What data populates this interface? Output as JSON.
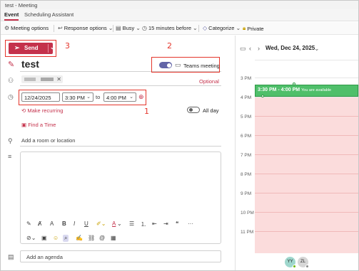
{
  "window": {
    "title": "test - Meeting"
  },
  "tabs": [
    {
      "label": "Event"
    },
    {
      "label": "Scheduling Assistant"
    }
  ],
  "toolbar": {
    "meeting_options": "Meeting options",
    "response_options": "Response options",
    "busy": "Busy",
    "reminder": "15 minutes before",
    "categorize": "Categorize",
    "private": "Private"
  },
  "send": {
    "label": "Send"
  },
  "form": {
    "title": "test",
    "teams_meeting_label": "Teams meeting",
    "teams_meeting_on": true,
    "optional_label": "Optional",
    "start_date": "12/24/2025",
    "start_time": "3:30 PM",
    "to_label": "to",
    "end_time": "4:00 PM",
    "all_day_label": "All day",
    "make_recurring": "Make recurring",
    "find_a_time": "Find a Time",
    "room_placeholder": "Add a room or location",
    "agenda_placeholder": "Add an agenda"
  },
  "annotations": {
    "one": "1",
    "two": "2",
    "three": "3"
  },
  "calendar": {
    "date_label": "Wed, Dec 24, 2025",
    "hours": [
      "3 PM",
      "4 PM",
      "5 PM",
      "6 PM",
      "7 PM",
      "8 PM",
      "9 PM",
      "10 PM",
      "11 PM"
    ],
    "event_time": "3:30 PM - 4:00 PM",
    "event_status": "You are available",
    "attendees": [
      {
        "initials": "YY",
        "status_color": "#6bb700"
      },
      {
        "initials": "ZL",
        "status_color": "#8a8a8a"
      }
    ]
  },
  "colors": {
    "accent": "#c4314b",
    "teams": "#6264a7",
    "event": "#4fbf6a",
    "busy": "#fbdcdc",
    "annotation": "#e4352b"
  }
}
